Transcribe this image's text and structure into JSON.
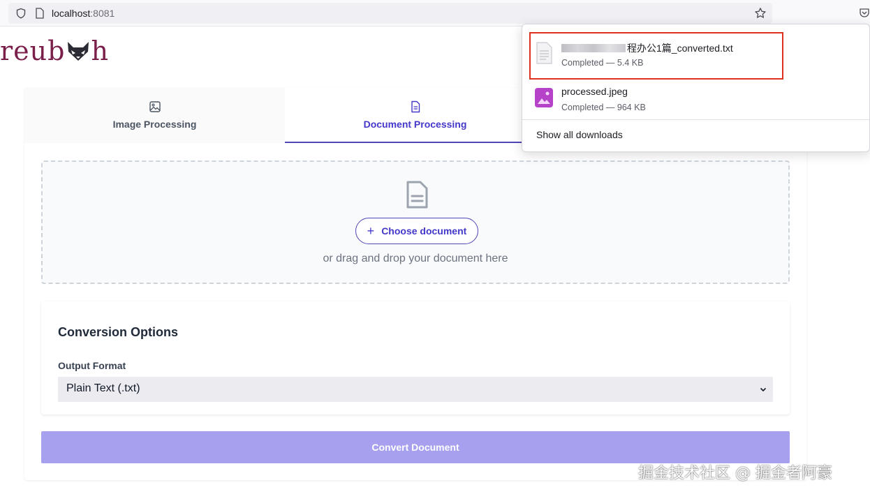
{
  "browser": {
    "url_host": "localhost",
    "url_port": ":8081"
  },
  "logo": {
    "text": "reub",
    "text_end": "h"
  },
  "tabs": [
    {
      "label": "Image Processing",
      "icon": "image-icon",
      "active": false
    },
    {
      "label": "Document Processing",
      "icon": "document-icon",
      "active": true
    }
  ],
  "dropzone": {
    "choose_label": "Choose document",
    "drag_text": "or drag and drop your document here"
  },
  "options": {
    "title": "Conversion Options",
    "output_format_label": "Output Format",
    "output_format_value": "Plain Text (.txt)"
  },
  "convert_label": "Convert Document",
  "downloads": {
    "items": [
      {
        "name_visible": "程办公1篇_converted.txt",
        "name_prefix_char": "",
        "status": "Completed — 5.4 KB",
        "icon": "text-file-icon"
      },
      {
        "name_visible": "processed.jpeg",
        "status": "Completed — 964 KB",
        "icon": "image-file-icon"
      }
    ],
    "show_all": "Show all downloads"
  },
  "watermark": "掘金技术社区 @ 掘金者阿豪",
  "colors": {
    "accent": "#4338ca",
    "convert_button": "#a7a0ee",
    "logo": "#7a1f4a",
    "highlight": "#e0301e"
  }
}
